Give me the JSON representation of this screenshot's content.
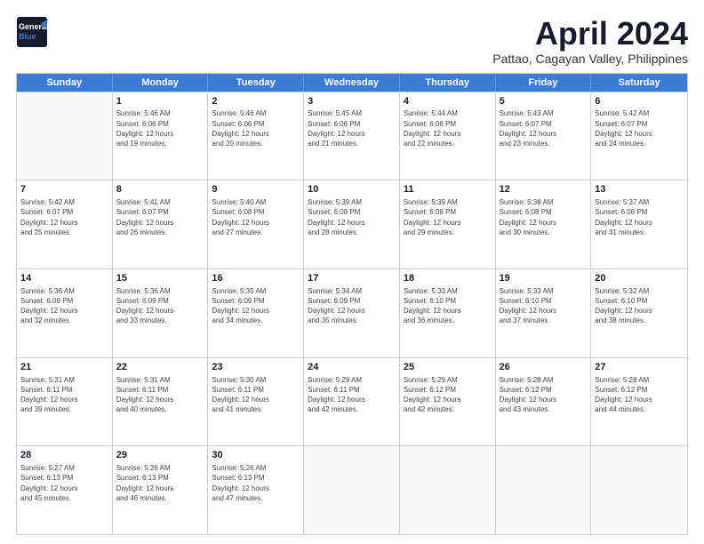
{
  "header": {
    "logo_line1": "General",
    "logo_line2": "Blue",
    "main_title": "April 2024",
    "subtitle": "Pattao, Cagayan Valley, Philippines"
  },
  "calendar": {
    "day_headers": [
      "Sunday",
      "Monday",
      "Tuesday",
      "Wednesday",
      "Thursday",
      "Friday",
      "Saturday"
    ],
    "rows": [
      [
        {
          "day": "",
          "info": ""
        },
        {
          "day": "1",
          "info": "Sunrise: 5:46 AM\nSunset: 6:06 PM\nDaylight: 12 hours\nand 19 minutes."
        },
        {
          "day": "2",
          "info": "Sunrise: 5:46 AM\nSunset: 6:06 PM\nDaylight: 12 hours\nand 20 minutes."
        },
        {
          "day": "3",
          "info": "Sunrise: 5:45 AM\nSunset: 6:06 PM\nDaylight: 12 hours\nand 21 minutes."
        },
        {
          "day": "4",
          "info": "Sunrise: 5:44 AM\nSunset: 6:06 PM\nDaylight: 12 hours\nand 22 minutes."
        },
        {
          "day": "5",
          "info": "Sunrise: 5:43 AM\nSunset: 6:07 PM\nDaylight: 12 hours\nand 23 minutes."
        },
        {
          "day": "6",
          "info": "Sunrise: 5:42 AM\nSunset: 6:07 PM\nDaylight: 12 hours\nand 24 minutes."
        }
      ],
      [
        {
          "day": "7",
          "info": "Sunrise: 5:42 AM\nSunset: 6:07 PM\nDaylight: 12 hours\nand 25 minutes."
        },
        {
          "day": "8",
          "info": "Sunrise: 5:41 AM\nSunset: 6:07 PM\nDaylight: 12 hours\nand 26 minutes."
        },
        {
          "day": "9",
          "info": "Sunrise: 5:40 AM\nSunset: 6:08 PM\nDaylight: 12 hours\nand 27 minutes."
        },
        {
          "day": "10",
          "info": "Sunrise: 5:39 AM\nSunset: 6:08 PM\nDaylight: 12 hours\nand 28 minutes."
        },
        {
          "day": "11",
          "info": "Sunrise: 5:39 AM\nSunset: 6:08 PM\nDaylight: 12 hours\nand 29 minutes."
        },
        {
          "day": "12",
          "info": "Sunrise: 5:38 AM\nSunset: 6:08 PM\nDaylight: 12 hours\nand 30 minutes."
        },
        {
          "day": "13",
          "info": "Sunrise: 5:37 AM\nSunset: 6:08 PM\nDaylight: 12 hours\nand 31 minutes."
        }
      ],
      [
        {
          "day": "14",
          "info": "Sunrise: 5:36 AM\nSunset: 6:09 PM\nDaylight: 12 hours\nand 32 minutes."
        },
        {
          "day": "15",
          "info": "Sunrise: 5:36 AM\nSunset: 6:09 PM\nDaylight: 12 hours\nand 33 minutes."
        },
        {
          "day": "16",
          "info": "Sunrise: 5:35 AM\nSunset: 6:09 PM\nDaylight: 12 hours\nand 34 minutes."
        },
        {
          "day": "17",
          "info": "Sunrise: 5:34 AM\nSunset: 6:09 PM\nDaylight: 12 hours\nand 35 minutes."
        },
        {
          "day": "18",
          "info": "Sunrise: 5:33 AM\nSunset: 6:10 PM\nDaylight: 12 hours\nand 36 minutes."
        },
        {
          "day": "19",
          "info": "Sunrise: 5:33 AM\nSunset: 6:10 PM\nDaylight: 12 hours\nand 37 minutes."
        },
        {
          "day": "20",
          "info": "Sunrise: 5:32 AM\nSunset: 6:10 PM\nDaylight: 12 hours\nand 38 minutes."
        }
      ],
      [
        {
          "day": "21",
          "info": "Sunrise: 5:31 AM\nSunset: 6:11 PM\nDaylight: 12 hours\nand 39 minutes."
        },
        {
          "day": "22",
          "info": "Sunrise: 5:31 AM\nSunset: 6:11 PM\nDaylight: 12 hours\nand 40 minutes."
        },
        {
          "day": "23",
          "info": "Sunrise: 5:30 AM\nSunset: 6:11 PM\nDaylight: 12 hours\nand 41 minutes."
        },
        {
          "day": "24",
          "info": "Sunrise: 5:29 AM\nSunset: 6:11 PM\nDaylight: 12 hours\nand 42 minutes."
        },
        {
          "day": "25",
          "info": "Sunrise: 5:29 AM\nSunset: 6:12 PM\nDaylight: 12 hours\nand 42 minutes."
        },
        {
          "day": "26",
          "info": "Sunrise: 5:28 AM\nSunset: 6:12 PM\nDaylight: 12 hours\nand 43 minutes."
        },
        {
          "day": "27",
          "info": "Sunrise: 5:28 AM\nSunset: 6:12 PM\nDaylight: 12 hours\nand 44 minutes."
        }
      ],
      [
        {
          "day": "28",
          "info": "Sunrise: 5:27 AM\nSunset: 6:13 PM\nDaylight: 12 hours\nand 45 minutes."
        },
        {
          "day": "29",
          "info": "Sunrise: 5:26 AM\nSunset: 6:13 PM\nDaylight: 12 hours\nand 46 minutes."
        },
        {
          "day": "30",
          "info": "Sunrise: 5:26 AM\nSunset: 6:13 PM\nDaylight: 12 hours\nand 47 minutes."
        },
        {
          "day": "",
          "info": ""
        },
        {
          "day": "",
          "info": ""
        },
        {
          "day": "",
          "info": ""
        },
        {
          "day": "",
          "info": ""
        }
      ]
    ]
  }
}
